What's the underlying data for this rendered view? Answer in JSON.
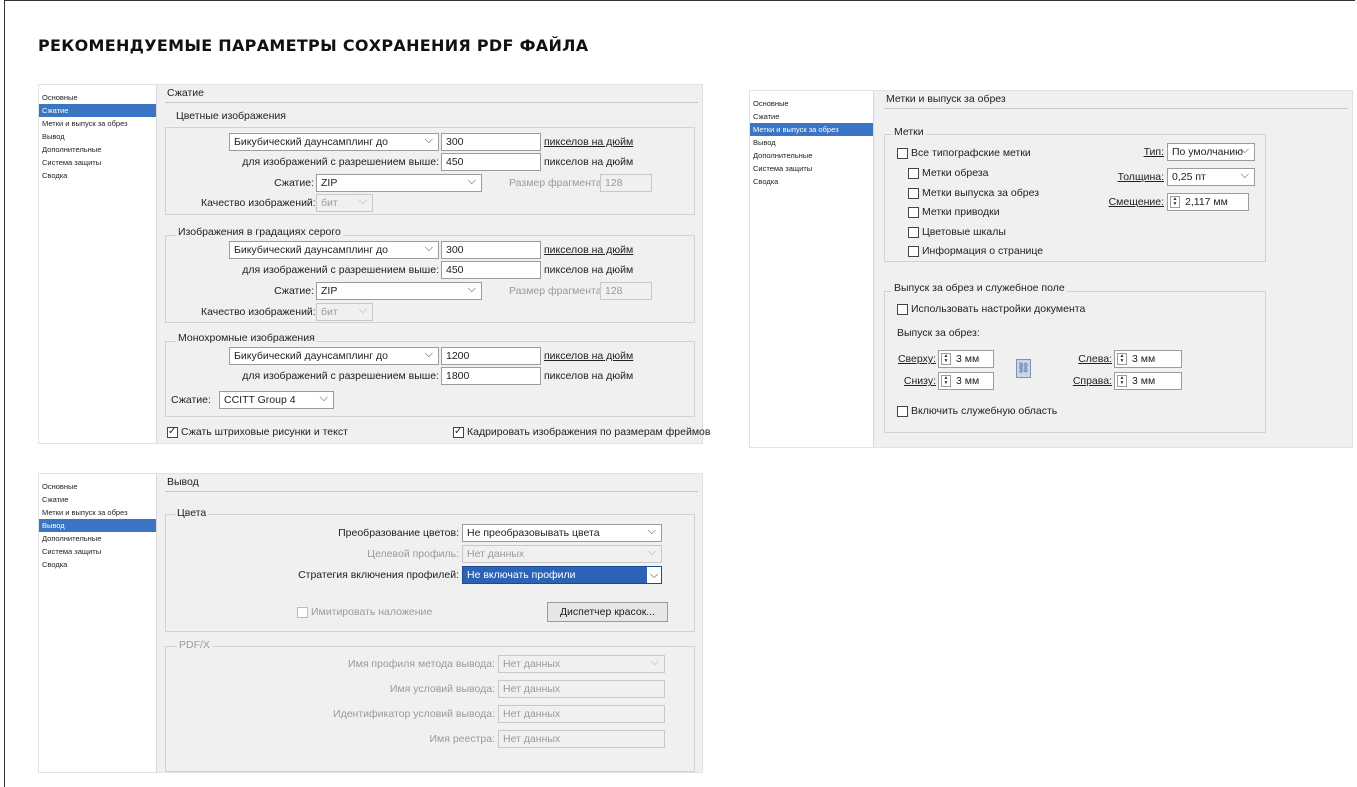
{
  "title": "РЕКОМЕНДУЕМЫЕ ПАРАМЕТРЫ СОХРАНЕНИЯ PDF ФАЙЛА",
  "sidebar": {
    "items": [
      "Основные",
      "Сжатие",
      "Метки и выпуск за обрез",
      "Вывод",
      "Дополнительные",
      "Система защиты",
      "Сводка"
    ]
  },
  "compression": {
    "header": "Сжатие",
    "color": {
      "title": "Цветные изображения",
      "resample": "Бикубический даунсамплинг до",
      "ppi": "300",
      "ppi_label": "пикселов на дюйм",
      "above_label": "для изображений с разрешением выше:",
      "above_value": "450",
      "above_unit": "пикселов на дюйм",
      "comp_label": "Сжатие:",
      "comp_value": "ZIP",
      "tile_label": "Размер фрагмента:",
      "tile_value": "128",
      "quality_label": "Качество изображений:",
      "quality_value": "бит"
    },
    "gray": {
      "title": "Изображения в градациях серого",
      "resample": "Бикубический даунсамплинг до",
      "ppi": "300",
      "ppi_label": "пикселов на дюйм",
      "above_label": "для изображений с разрешением выше:",
      "above_value": "450",
      "above_unit": "пикселов на дюйм",
      "comp_label": "Сжатие:",
      "comp_value": "ZIP",
      "tile_label": "Размер фрагмента:",
      "tile_value": "128",
      "quality_label": "Качество изображений:",
      "quality_value": "бит"
    },
    "mono": {
      "title": "Монохромные изображения",
      "resample": "Бикубический даунсамплинг до",
      "ppi": "1200",
      "ppi_label": "пикселов на дюйм",
      "above_label": "для изображений с разрешением выше:",
      "above_value": "1800",
      "above_unit": "пикселов на дюйм",
      "comp_label": "Сжатие:",
      "comp_value": "CCITT Group 4"
    },
    "compress_text": "Сжать штриховые рисунки и текст",
    "crop_images": "Кадрировать изображения по размерам фреймов"
  },
  "marks": {
    "header": "Метки и выпуск за обрез",
    "group_title": "Метки",
    "all_marks": "Все типографские метки",
    "crop_marks": "Метки обреза",
    "bleed_marks": "Метки выпуска за обрез",
    "reg_marks": "Метки приводки",
    "color_bars": "Цветовые шкалы",
    "page_info": "Информация о странице",
    "type_label": "Тип:",
    "type_value": "По умолчанию",
    "weight_label": "Толщина:",
    "weight_value": "0,25 пт",
    "offset_label": "Смещение:",
    "offset_value": "2,117 мм",
    "bleed_group_title": "Выпуск за обрез и служебное поле",
    "use_doc": "Использовать настройки документа",
    "bleed_label": "Выпуск за обрез:",
    "top_label": "Сверху:",
    "top_value": "3 мм",
    "bottom_label": "Снизу:",
    "bottom_value": "3 мм",
    "left_label": "Слева:",
    "left_value": "3 мм",
    "right_label": "Справа:",
    "right_value": "3 мм",
    "slug": "Включить служебную область"
  },
  "output": {
    "header": "Вывод",
    "colors_title": "Цвета",
    "conv_label": "Преобразование цветов:",
    "conv_value": "Не преобразовывать цвета",
    "dest_label": "Целевой профиль:",
    "dest_value": "Нет данных",
    "incl_label": "Стратегия включения профилей:",
    "incl_value": "Не включать профили",
    "simulate": "Имитировать наложение",
    "ink_manager": "Диспетчер красок...",
    "pdfx_title": "PDF/X",
    "intent_label": "Имя профиля метода вывода:",
    "intent_value": "Нет данных",
    "cond_label": "Имя условий вывода:",
    "cond_value": "Нет данных",
    "cond_id_label": "Идентификатор условий вывода:",
    "cond_id_value": "Нет данных",
    "registry_label": "Имя реестра:",
    "registry_value": "Нет данных"
  }
}
